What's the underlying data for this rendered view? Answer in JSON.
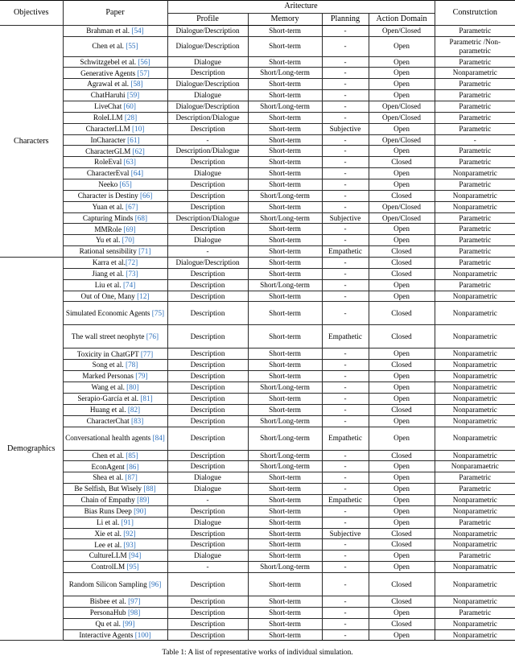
{
  "table": {
    "header": {
      "objectives": "Objectives",
      "paper": "Paper",
      "architecture_group": "Aritecture",
      "profile": "Profile",
      "memory": "Memory",
      "planning": "Planning",
      "action_domain": "Action Domain",
      "construction": "Construtction"
    },
    "sections": [
      {
        "objective": "Characters",
        "rows": [
          {
            "paper": "Brahman et al.",
            "ref": "54",
            "profile": "Dialogue/Description",
            "memory": "Short-term",
            "planning": "-",
            "action": "Open/Closed",
            "construction": "Parametric"
          },
          {
            "paper": "Chen et al.",
            "ref": "55",
            "profile": "Dialogue/Description",
            "memory": "Short-term",
            "planning": "-",
            "action": "Open",
            "construction": "Parametric /Non-parametric"
          },
          {
            "paper": "Schwitzgebel et al.",
            "ref": "56",
            "profile": "Dialogue",
            "memory": "Short-term",
            "planning": "-",
            "action": "Open",
            "construction": "Parametric"
          },
          {
            "paper": "Generative Agents",
            "ref": "57",
            "profile": "Description",
            "memory": "Short/Long-term",
            "planning": "-",
            "action": "Open",
            "construction": "Nonparametric"
          },
          {
            "paper": "Agrawal et al.",
            "ref": "58",
            "profile": "Dialogue/Description",
            "memory": "Short-term",
            "planning": "-",
            "action": "Open",
            "construction": "Parametric"
          },
          {
            "paper": "ChatHaruhi",
            "ref": "59",
            "profile": "Dialogue",
            "memory": "Short-term",
            "planning": "-",
            "action": "Open",
            "construction": "Parametric"
          },
          {
            "paper": "LiveChat",
            "ref": "60",
            "profile": "Dialogue/Description",
            "memory": "Short/Long-term",
            "planning": "-",
            "action": "Open/Closed",
            "construction": "Parametric"
          },
          {
            "paper": "RoleLLM",
            "ref": "28",
            "profile": "Description/Dialogue",
            "memory": "Short-term",
            "planning": "-",
            "action": "Open/Closed",
            "construction": "Parametric"
          },
          {
            "paper": "CharacterLLM",
            "ref": "10",
            "profile": "Description",
            "memory": "Short-term",
            "planning": "Subjective",
            "action": "Open",
            "construction": "Parametric"
          },
          {
            "paper": "InCharacter",
            "ref": "61",
            "profile": "-",
            "memory": "Short-term",
            "planning": "-",
            "action": "Open/Closed",
            "construction": "-"
          },
          {
            "paper": "CharacterGLM",
            "ref": "62",
            "profile": "Description/Dialogue",
            "memory": "Short-term",
            "planning": "-",
            "action": "Open",
            "construction": "Parametric"
          },
          {
            "paper": "RoleEval",
            "ref": "63",
            "profile": "Description",
            "memory": "Short-term",
            "planning": "-",
            "action": "Closed",
            "construction": "Parametric"
          },
          {
            "paper": "CharacterEval",
            "ref": "64",
            "profile": "Dialogue",
            "memory": "Short-term",
            "planning": "-",
            "action": "Open",
            "construction": "Nonparametric"
          },
          {
            "paper": "Neeko",
            "ref": "65",
            "profile": "Description",
            "memory": "Short-term",
            "planning": "-",
            "action": "Open",
            "construction": "Parametric"
          },
          {
            "paper": "Character is Destiny",
            "ref": "66",
            "profile": "Description",
            "memory": "Short/Long-term",
            "planning": "-",
            "action": "Closed",
            "construction": "Nonparametric"
          },
          {
            "paper": "Yuan et al.",
            "ref": "67",
            "profile": "Description",
            "memory": "Short-term",
            "planning": "-",
            "action": "Open/Closed",
            "construction": "Nonparametric"
          },
          {
            "paper": "Capturing Minds",
            "ref": "68",
            "profile": "Description/Dialogue",
            "memory": "Short/Long-term",
            "planning": "Subjective",
            "action": "Open/Closed",
            "construction": "Parametric"
          },
          {
            "paper": "MMRole",
            "ref": "69",
            "profile": "Description",
            "memory": "Short-term",
            "planning": "-",
            "action": "Open",
            "construction": "Parametric"
          },
          {
            "paper": "Yu et al.",
            "ref": "70",
            "profile": "Dialogue",
            "memory": "Short-term",
            "planning": "-",
            "action": "Open",
            "construction": "Parametric"
          },
          {
            "paper": "Rational sensibility",
            "ref": "71",
            "profile": "-",
            "memory": "Short-term",
            "planning": "Empathetic",
            "action": "Closed",
            "construction": "Parametric"
          }
        ]
      },
      {
        "objective": "Demographics",
        "rows": [
          {
            "paper": "Karra et al.",
            "ref": "72",
            "nospace": true,
            "profile": "Dialogue/Description",
            "memory": "Short-term",
            "planning": "-",
            "action": "Closed",
            "construction": "Parametric"
          },
          {
            "paper": "Jiang et al.",
            "ref": "73",
            "profile": "Description",
            "memory": "Short-term",
            "planning": "-",
            "action": "Closed",
            "construction": "Nonparametric"
          },
          {
            "paper": "Liu et al.",
            "ref": "74",
            "profile": "Description",
            "memory": "Short/Long-term",
            "planning": "-",
            "action": "Open",
            "construction": "Parametric"
          },
          {
            "paper": "Out of One, Many",
            "ref": "12",
            "profile": "Description",
            "memory": "Short-term",
            "planning": "-",
            "action": "Open",
            "construction": "Nonparametric"
          },
          {
            "paper": "Simulated Economic Agents",
            "ref": "75",
            "twoline": true,
            "profile": "Description",
            "memory": "Short-term",
            "planning": "-",
            "action": "Closed",
            "construction": "Nonparametric"
          },
          {
            "paper": "The wall street neophyte",
            "ref": "76",
            "twoline": true,
            "profile": "Description",
            "memory": "Short-term",
            "planning": "Empathetic",
            "action": "Closed",
            "construction": "Nonparametric"
          },
          {
            "paper": "Toxicity in ChatGPT",
            "ref": "77",
            "profile": "Description",
            "memory": "Short-term",
            "planning": "-",
            "action": "Open",
            "construction": "Nonparametric"
          },
          {
            "paper": "Song et al.",
            "ref": "78",
            "profile": "Description",
            "memory": "Short-term",
            "planning": "-",
            "action": "Closed",
            "construction": "Nonparametric"
          },
          {
            "paper": "Marked Personas",
            "ref": "79",
            "profile": "Description",
            "memory": "Short-term",
            "planning": "-",
            "action": "Open",
            "construction": "Nonparametric"
          },
          {
            "paper": "Wang et al.",
            "ref": "80",
            "profile": "Description",
            "memory": "Short/Long-term",
            "planning": "-",
            "action": "Open",
            "construction": "Nonparametric"
          },
          {
            "paper": "Serapio-García et al.",
            "ref": "81",
            "profile": "Description",
            "memory": "Short-term",
            "planning": "-",
            "action": "Open",
            "construction": "Nonparametric"
          },
          {
            "paper": "Huang et al.",
            "ref": "82",
            "profile": "Description",
            "memory": "Short-term",
            "planning": "-",
            "action": "Closed",
            "construction": "Nonparametric"
          },
          {
            "paper": "CharacterChat",
            "ref": "83",
            "profile": "Description",
            "memory": "Short/Long-term",
            "planning": "-",
            "action": "Open",
            "construction": "Nonparametric"
          },
          {
            "paper": "Conversational health agents",
            "ref": "84",
            "twoline": true,
            "profile": "Description",
            "memory": "Short/Long-term",
            "planning": "Empathetic",
            "action": "Open",
            "construction": "Nonparametric"
          },
          {
            "paper": "Chen et al.",
            "ref": "85",
            "profile": "Description",
            "memory": "Short/Long-term",
            "planning": "-",
            "action": "Closed",
            "construction": "Nonparametric"
          },
          {
            "paper": "EconAgent",
            "ref": "86",
            "profile": "Description",
            "memory": "Short/Long-term",
            "planning": "-",
            "action": "Open",
            "construction": "Nonparamaetric"
          },
          {
            "paper": "Shea et al.",
            "ref": "87",
            "profile": "Dialogue",
            "memory": "Short-term",
            "planning": "-",
            "action": "Open",
            "construction": "Parametric"
          },
          {
            "paper": "Be Selfish, But Wisely",
            "ref": "88",
            "profile": "Dialogue",
            "memory": "Short-term",
            "planning": "-",
            "action": "Open",
            "construction": "Parametric"
          },
          {
            "paper": "Chain of Empathy",
            "ref": "89",
            "profile": "-",
            "memory": "Short-term",
            "planning": "Empathetic",
            "action": "Open",
            "construction": "Nonparametric"
          },
          {
            "paper": "Bias Runs Deep",
            "ref": "90",
            "profile": "Description",
            "memory": "Short-term",
            "planning": "-",
            "action": "Open",
            "construction": "Nonparametric"
          },
          {
            "paper": "Li et al.",
            "ref": "91",
            "profile": "Dialogue",
            "memory": "Short-term",
            "planning": "-",
            "action": "Open",
            "construction": "Parametric"
          },
          {
            "paper": "Xie et al.",
            "ref": "92",
            "profile": "Description",
            "memory": "Short-term",
            "planning": "Subjective",
            "action": "Closed",
            "construction": "Nonparametric"
          },
          {
            "paper": "Lee et al.",
            "ref": "93",
            "profile": "Description",
            "memory": "Short-term",
            "planning": "-",
            "action": "Closed",
            "construction": "Nonparametric"
          },
          {
            "paper": "CultureLLM",
            "ref": "94",
            "profile": "Dialogue",
            "memory": "Short-term",
            "planning": "-",
            "action": "Open",
            "construction": "Parametric"
          },
          {
            "paper": "ControlLM",
            "ref": "95",
            "profile": "-",
            "memory": "Short/Long-term",
            "planning": "-",
            "action": "Open",
            "construction": "Nonparamatric"
          },
          {
            "paper": "Random Silicon Sampling",
            "ref": "96",
            "twoline": true,
            "profile": "Description",
            "memory": "Short-term",
            "planning": "-",
            "action": "Closed",
            "construction": "Nonparametric"
          },
          {
            "paper": "Bisbee et al.",
            "ref": "97",
            "profile": "Description",
            "memory": "Short-term",
            "planning": "-",
            "action": "Closed",
            "construction": "Nonparametric"
          },
          {
            "paper": "PersonaHub",
            "ref": "98",
            "profile": "Description",
            "memory": "Short-term",
            "planning": "-",
            "action": "Open",
            "construction": "Parametric"
          },
          {
            "paper": "Qu et al.",
            "ref": "99",
            "profile": "Description",
            "memory": "Short-term",
            "planning": "-",
            "action": "Closed",
            "construction": "Nonparametric"
          },
          {
            "paper": "Interactive Agents",
            "ref": "100",
            "profile": "Description",
            "memory": "Short-term",
            "planning": "-",
            "action": "Open",
            "construction": "Nonparametric"
          }
        ]
      }
    ]
  },
  "caption": "Table 1: A list of representative works of individual simulation.",
  "colors": {
    "citation": "#2a6ebb",
    "rule": "#000000",
    "text": "#000000"
  }
}
